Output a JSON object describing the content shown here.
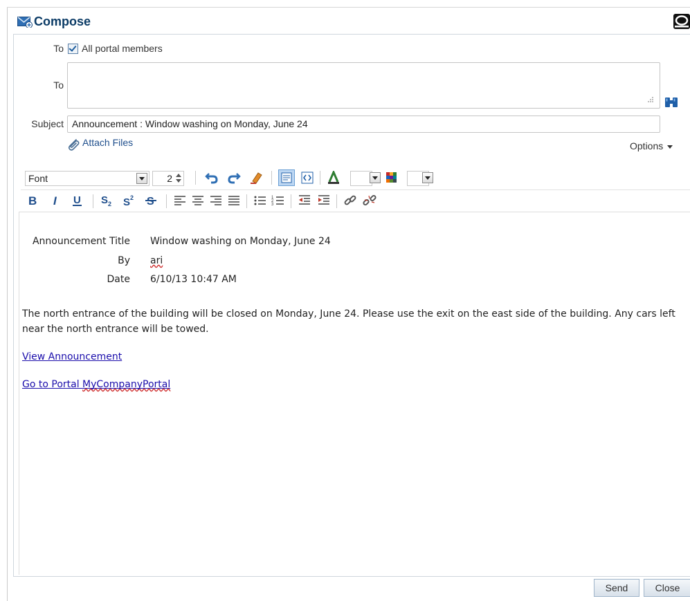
{
  "window": {
    "title": "Compose"
  },
  "compose": {
    "to_checkbox_label": "To",
    "all_members_label": "All portal members",
    "all_members_checked": true,
    "to_label": "To",
    "to_value": "",
    "subject_label": "Subject",
    "subject_value": "Announcement : Window washing on Monday, June 24",
    "attach_label": "Attach Files",
    "options_label": "Options"
  },
  "toolbar": {
    "font_value": "Font",
    "size_value": "2",
    "row1_icons": [
      "undo-icon",
      "redo-icon",
      "clear-format-icon",
      "rich-text-mode-icon",
      "source-mode-icon",
      "text-color-icon",
      "background-color-icon"
    ],
    "row2_icons": [
      "bold-icon",
      "italic-icon",
      "underline-icon",
      "subscript-icon",
      "superscript-icon",
      "strikethrough-icon",
      "align-left-icon",
      "align-center-icon",
      "align-right-icon",
      "justify-icon",
      "bulleted-list-icon",
      "numbered-list-icon",
      "outdent-icon",
      "indent-icon",
      "link-icon",
      "unlink-icon"
    ]
  },
  "message": {
    "announcement_title_label": "Announcement Title",
    "announcement_title_value": "Window washing on Monday, June 24",
    "by_label": "By",
    "by_value": "ari",
    "date_label": "Date",
    "date_value": "6/10/13 10:47 AM",
    "body": "The north entrance of the building will be closed on Monday, June 24. Please use the exit on the east side of the building. Any cars left near the north entrance will be towed.",
    "link_view": "View Announcement",
    "link_portal_prefix": "Go to Portal ",
    "link_portal_name": "MyCompanyPortal"
  },
  "buttons": {
    "send": "Send",
    "close": "Close"
  },
  "colors": {
    "title": "#0b3b66",
    "link": "#1a0dab",
    "accent_blue": "#1e4e8c"
  }
}
